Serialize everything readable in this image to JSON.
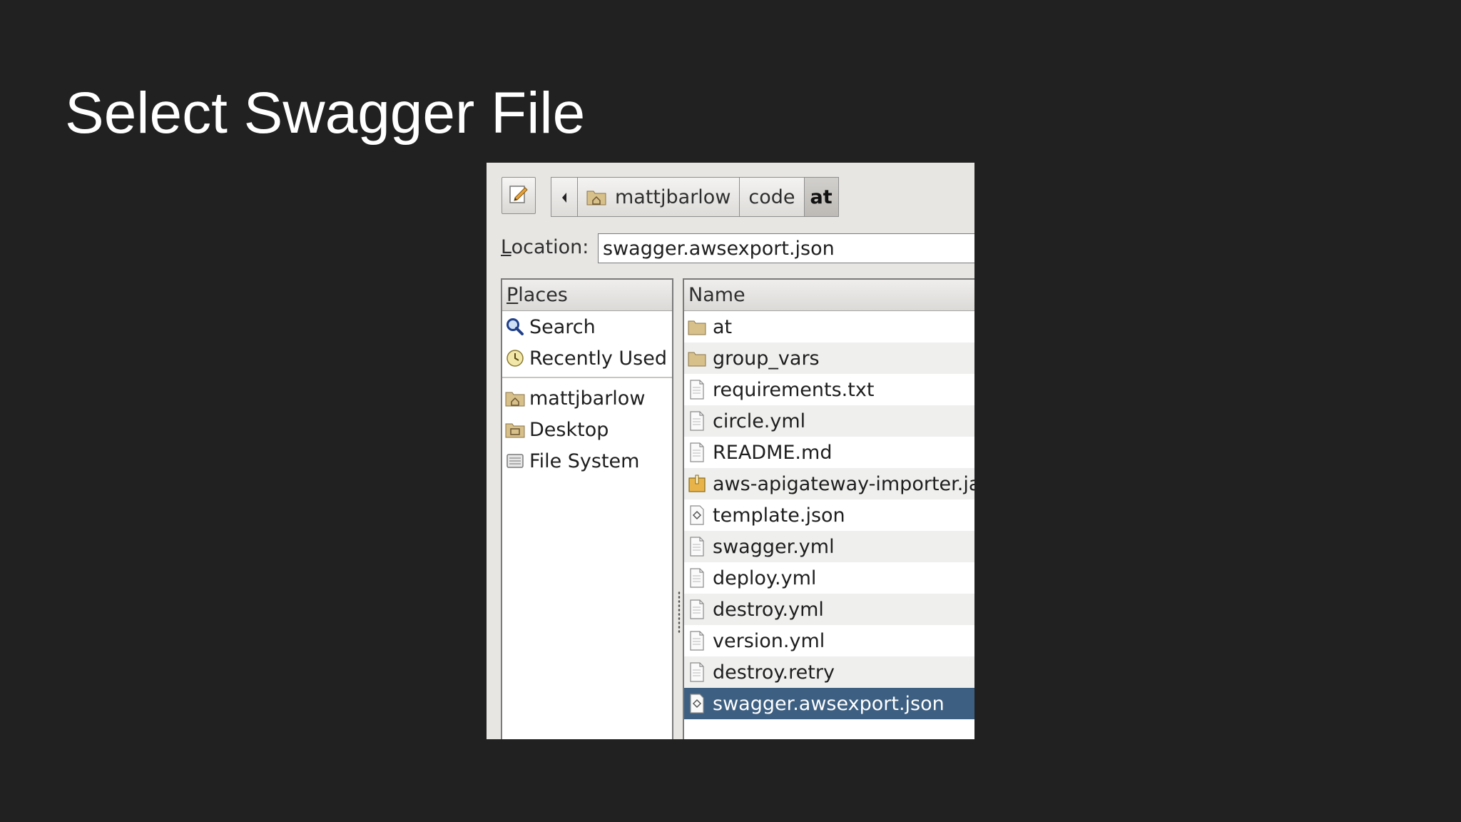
{
  "slide": {
    "title": "Select Swagger File"
  },
  "dialog": {
    "pathbar": [
      "mattjbarlow",
      "code",
      "at"
    ],
    "location": {
      "label": "Location:",
      "value": "swagger.awsexport.json"
    },
    "places": {
      "header": "Places",
      "items": [
        {
          "label": "Search",
          "icon": "search-icon"
        },
        {
          "label": "Recently Used",
          "icon": "recent-icon"
        }
      ],
      "bookmarks": [
        {
          "label": "mattjbarlow",
          "icon": "home-folder-icon"
        },
        {
          "label": "Desktop",
          "icon": "desktop-folder-icon"
        },
        {
          "label": "File System",
          "icon": "drive-icon"
        }
      ]
    },
    "files": {
      "header": "Name",
      "items": [
        {
          "name": "at",
          "icon": "folder-icon"
        },
        {
          "name": "group_vars",
          "icon": "folder-icon"
        },
        {
          "name": "requirements.txt",
          "icon": "text-file-icon"
        },
        {
          "name": "circle.yml",
          "icon": "text-file-icon"
        },
        {
          "name": "README.md",
          "icon": "text-file-icon"
        },
        {
          "name": "aws-apigateway-importer.jar",
          "icon": "archive-icon"
        },
        {
          "name": "template.json",
          "icon": "json-file-icon"
        },
        {
          "name": "swagger.yml",
          "icon": "text-file-icon"
        },
        {
          "name": "deploy.yml",
          "icon": "text-file-icon"
        },
        {
          "name": "destroy.yml",
          "icon": "text-file-icon"
        },
        {
          "name": "version.yml",
          "icon": "text-file-icon"
        },
        {
          "name": "destroy.retry",
          "icon": "text-file-icon"
        },
        {
          "name": "swagger.awsexport.json",
          "icon": "json-file-icon",
          "selected": true
        }
      ]
    },
    "colors": {
      "selection": "#3d5f82",
      "background": "#212121"
    }
  }
}
